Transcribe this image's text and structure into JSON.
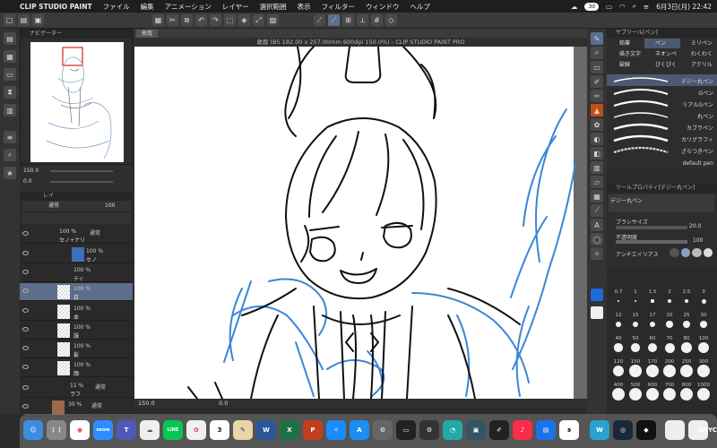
{
  "menubar": {
    "app_name": "CLIP STUDIO PAINT",
    "items": [
      "ファイル",
      "編集",
      "アニメーション",
      "レイヤー",
      "選択範囲",
      "表示",
      "フィルター",
      "ウィンドウ",
      "ヘルプ"
    ],
    "status_pill": "3d",
    "date_time": "6月3日(月) 22:42"
  },
  "navigator": {
    "title": "ナビゲーター",
    "zoom": "150.0",
    "angle": "0.0"
  },
  "layers": {
    "title": "レイ",
    "blend_mode": "通常",
    "opacity": "100",
    "rows": [
      {
        "pct": "100 %",
        "mode": "通常",
        "name": "セノ+ナリ"
      },
      {
        "pct": "100 %",
        "mode": "通常",
        "name": "セノ"
      },
      {
        "pct": "100 %",
        "mode": "通常",
        "name": "ティ"
      },
      {
        "pct": "100 %",
        "mode": "通常",
        "name": "目"
      },
      {
        "pct": "100 %",
        "mode": "通常",
        "name": "本"
      },
      {
        "pct": "100 %",
        "mode": "通常",
        "name": "服"
      },
      {
        "pct": "100 %",
        "mode": "通常",
        "name": "髪"
      },
      {
        "pct": "100 %",
        "mode": "通常",
        "name": "顔"
      },
      {
        "pct": "11 %",
        "mode": "通常",
        "name": "ラフ"
      },
      {
        "pct": "30 %",
        "mode": "通常",
        "name": ""
      }
    ]
  },
  "document": {
    "tab_label": "敦煌",
    "title": "敦煌 (B5 182.00 x 257.00mm 600dpi 150.0%) - CLIP STUDIO PAINT PRO",
    "zoom": "150.0",
    "angle": "0.0"
  },
  "subtool": {
    "panel_title": "サブツール[ペン]",
    "groups": [
      "鉛筆",
      "ペン",
      "ミリペン",
      "描き文字",
      "ネオンペ",
      "わくわく",
      "破線",
      "ぴくぴく",
      "アクリル"
    ],
    "brushes": [
      "デジー丸ペン",
      "Gペン",
      "リアルGペン",
      "丸ペン",
      "カブラペン",
      "カリグラフィ",
      "ざらつきペン"
    ],
    "default_label": "default pen"
  },
  "tool_property": {
    "title": "ツールプロパティ[デジー丸ペン]",
    "brush_name": "デジー丸ペン",
    "size_label": "ブラシサイズ",
    "size_value": "20.0",
    "density_label": "不透明度",
    "density_value": "100",
    "aa_label": "アンチエイリアス"
  },
  "brush_sizes": [
    "0.7",
    "1",
    "1.5",
    "2",
    "2.5",
    "3",
    "12",
    "15",
    "17",
    "20",
    "25",
    "30",
    "40",
    "50",
    "60",
    "70",
    "80",
    "100",
    "120",
    "150",
    "170",
    "200",
    "250",
    "300",
    "400",
    "500",
    "600",
    "700",
    "800",
    "1000"
  ],
  "dock": {
    "apps": [
      "Finder",
      "Launchpad",
      "Chrome",
      "Zoom",
      "Teams",
      "LINE",
      "Photos",
      "Calendar",
      "Word",
      "Excel",
      "PowerPoint",
      "Safari",
      "App Store",
      "Settings",
      "Preview",
      "Music",
      "Keynote",
      "Pen",
      "Weibo",
      "Steam",
      "Notes"
    ],
    "zoom_label": "zoom",
    "line_label": "LINE",
    "w_label": "W",
    "x_label": "X",
    "p_label": "P",
    "cal_day": "3",
    "trailing_text": "ANYC"
  },
  "colors": {
    "canvas_white": "#ffffff",
    "line_black": "#111111",
    "sketch_blue": "#3a86d8",
    "selection": "#5b6e8a",
    "nav_box": "#e02020"
  }
}
